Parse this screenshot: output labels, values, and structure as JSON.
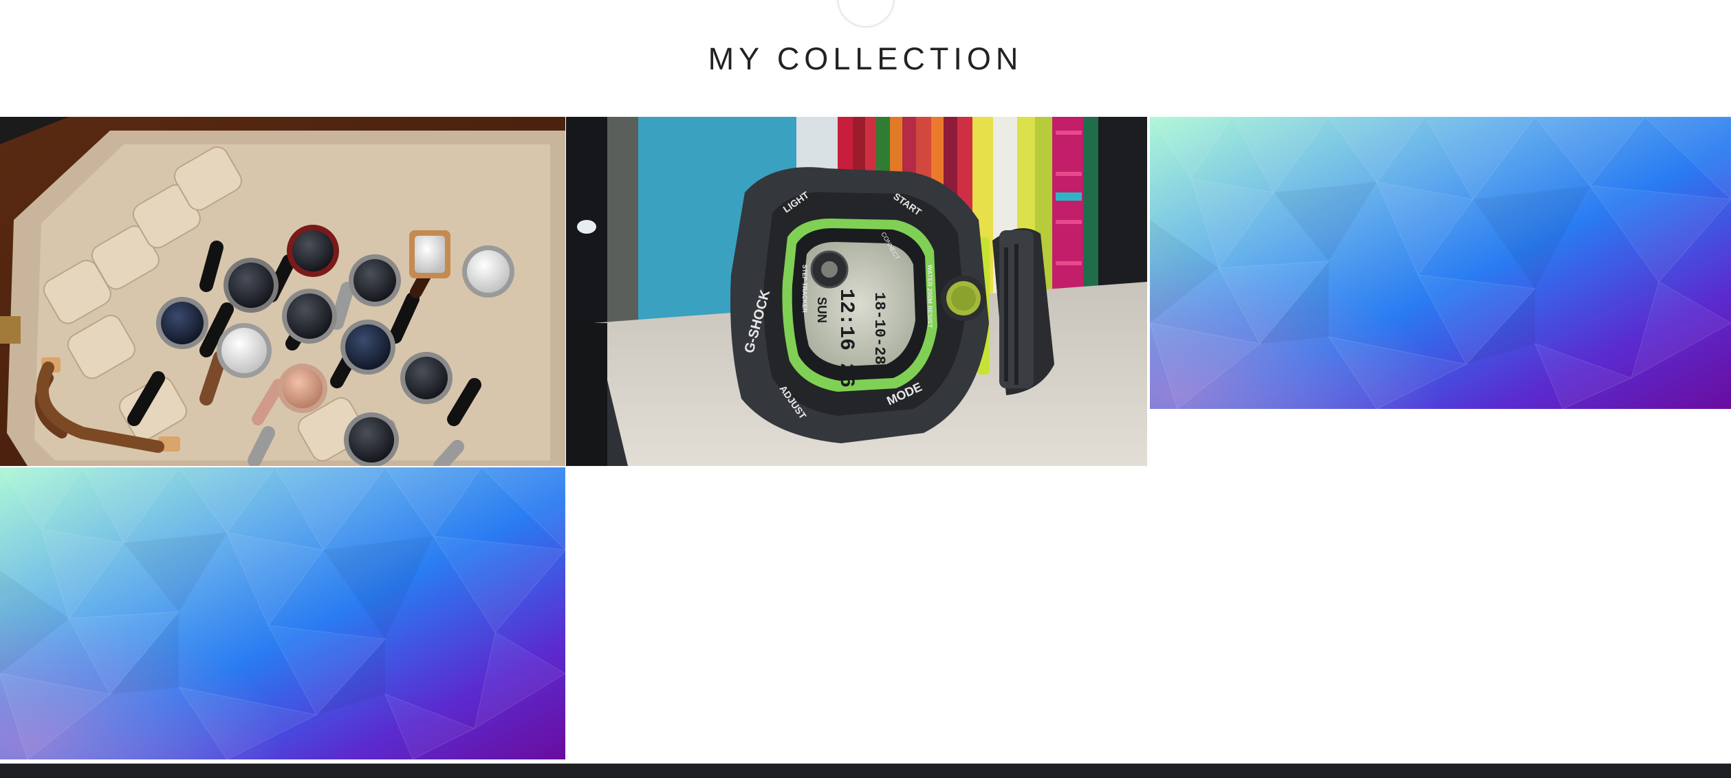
{
  "page": {
    "title": "MY COLLECTION"
  },
  "gallery": {
    "tiles": [
      {
        "name": "watch-case-photo",
        "content": "photo: briefcase watch box with fourteen wristwatches"
      },
      {
        "name": "gshock-photo",
        "content": "photo: black and green G-SHOCK digital watch on a shelf"
      },
      {
        "name": "gradient-placeholder-1",
        "content": "low-poly gradient placeholder"
      },
      {
        "name": "gradient-placeholder-2",
        "content": "low-poly gradient placeholder"
      }
    ],
    "gshock_text": {
      "brand": "G-SHOCK",
      "light": "LIGHT",
      "start": "START",
      "mode": "MODE",
      "adjust": "ADJUST",
      "connect": "CONNECT",
      "step": "STEP TRACKER",
      "water": "WATER 200M RESIST",
      "day": "SUN",
      "time": "12:16 26",
      "date": "18-10-28"
    }
  },
  "colors": {
    "background": "#ffffff",
    "title": "#222222",
    "footer": "#1f2023",
    "gradient_stops": [
      "#aef7d6",
      "#2a7cf2",
      "#5b2bd0",
      "#6a0c9e"
    ]
  }
}
